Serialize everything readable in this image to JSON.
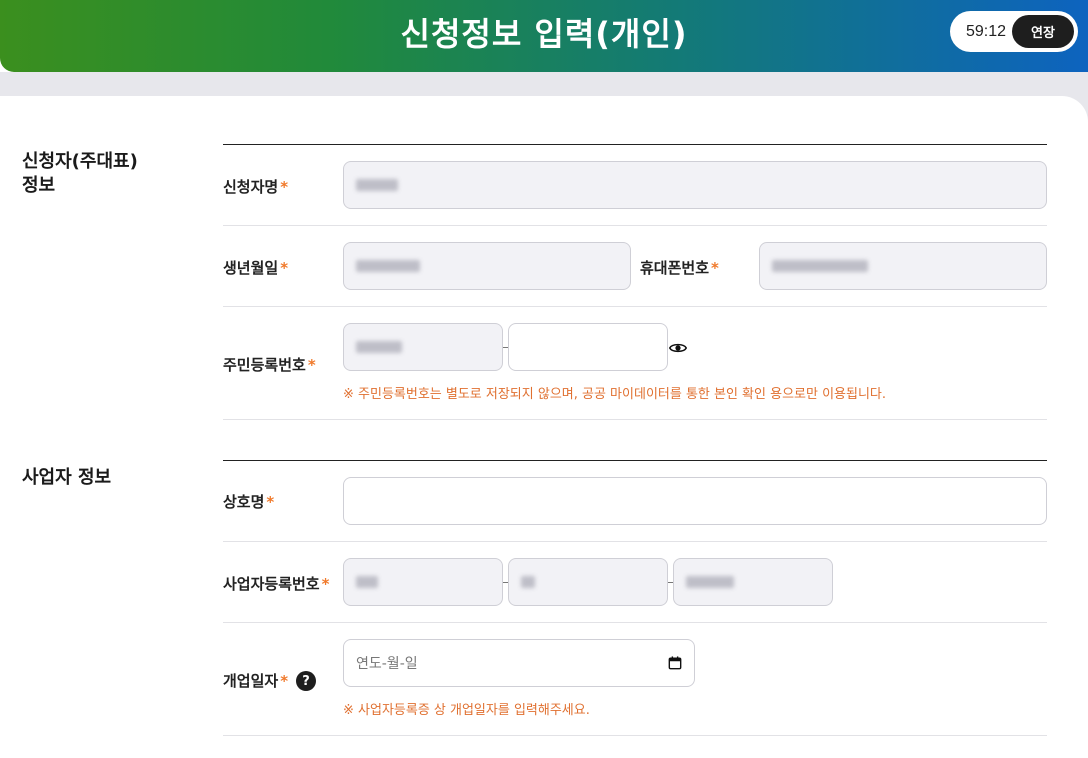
{
  "header": {
    "title": "신청정보 입력(개인)",
    "timer": "59:12",
    "extend_label": "연장"
  },
  "applicant": {
    "section_title": "신청자(주대표)\n정보",
    "name_label": "신청자명",
    "birth_label": "생년월일",
    "phone_label": "휴대폰번호",
    "rrn_label": "주민등록번호",
    "rrn_note": "※ 주민등록번호는 별도로 저장되지 않으며, 공공 마이데이터를 통한 본인 확인 용으로만 이용됩니다.",
    "required_mark": "*"
  },
  "business": {
    "section_title": "사업자 정보",
    "trade_name_label": "상호명",
    "brn_label": "사업자등록번호",
    "open_date_label": "개업일자",
    "open_date_placeholder": "연도-월-일",
    "open_date_note": "※ 사업자등록증 상 개업일자를 입력해주세요.",
    "help_symbol": "?",
    "required_mark": "*"
  },
  "icons": {
    "eye": "eye-icon",
    "calendar": "calendar-icon",
    "help": "help-icon"
  },
  "colors": {
    "required": "#f07a2c",
    "note": "#e07030",
    "header_start": "#3b8f1e",
    "header_end": "#0d63bf"
  }
}
